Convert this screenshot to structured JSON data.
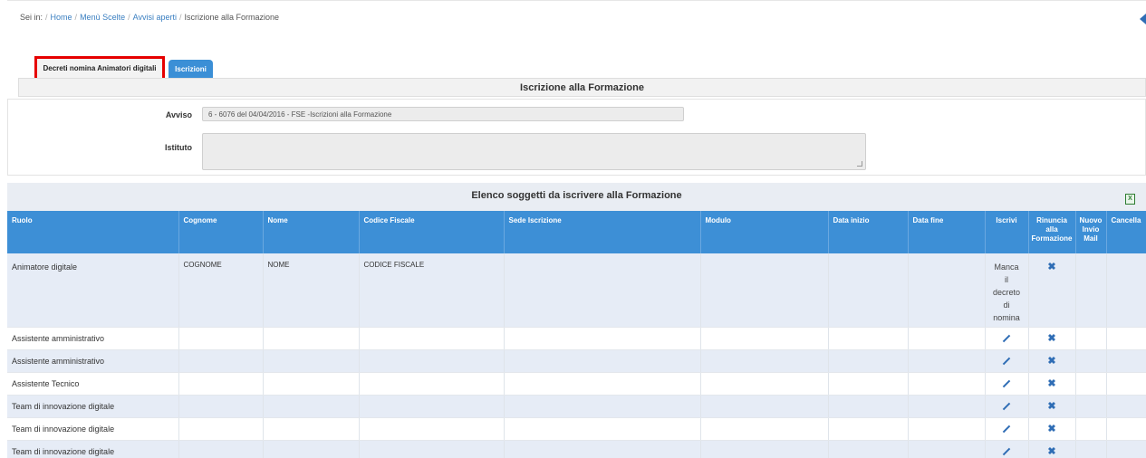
{
  "breadcrumb": {
    "prefix": "Sei in:",
    "items": [
      "Home",
      "Menù Scelte",
      "Avvisi aperti"
    ],
    "current": "Iscrizione alla Formazione"
  },
  "tabs": [
    {
      "label": "Decreti nomina Animatori digitali",
      "active": true
    },
    {
      "label": "Iscrizioni",
      "active": false
    }
  ],
  "section_title": "Iscrizione alla Formazione",
  "form": {
    "avviso_label": "Avviso",
    "avviso_value": "6 - 6076 del 04/04/2016 - FSE -Iscrizioni alla Formazione",
    "istituto_label": "Istituto",
    "istituto_value": ""
  },
  "table": {
    "title": "Elenco soggetti da iscrivere alla Formazione",
    "headers": {
      "ruolo": "Ruolo",
      "cognome": "Cognome",
      "nome": "Nome",
      "codice_fiscale": "Codice Fiscale",
      "sede": "Sede Iscrizione",
      "modulo": "Modulo",
      "data_inizio": "Data inizio",
      "data_fine": "Data fine",
      "iscrivi": "Iscrivi",
      "rinuncia_1": "Rinuncia",
      "rinuncia_2": "alla",
      "rinuncia_3": "Formazione",
      "nuovo_1": "Nuovo",
      "nuovo_2": "Invio",
      "nuovo_3": "Mail",
      "cancella": "Cancella"
    },
    "first_row": {
      "ruolo": "Animatore digitale",
      "cognome": "COGNOME",
      "nome": "NOME",
      "codice_fiscale": "CODICE FISCALE",
      "manca_1": "Manca",
      "manca_2": "il",
      "manca_3": "decreto",
      "manca_4": "di",
      "manca_5": "nomina"
    },
    "rows": [
      {
        "ruolo": "Assistente amministrativo"
      },
      {
        "ruolo": "Assistente amministrativo"
      },
      {
        "ruolo": "Assistente Tecnico"
      },
      {
        "ruolo": "Team di innovazione digitale"
      },
      {
        "ruolo": "Team di innovazione digitale"
      },
      {
        "ruolo": "Team di innovazione digitale"
      }
    ]
  },
  "icons": {
    "edit": "pencil-icon",
    "cancel": "x-icon",
    "export": "excel-icon",
    "back": "arrow-left-icon"
  },
  "colors": {
    "accent": "#3d8fd6",
    "highlight": "#e60000",
    "link": "#3a7fc1"
  }
}
